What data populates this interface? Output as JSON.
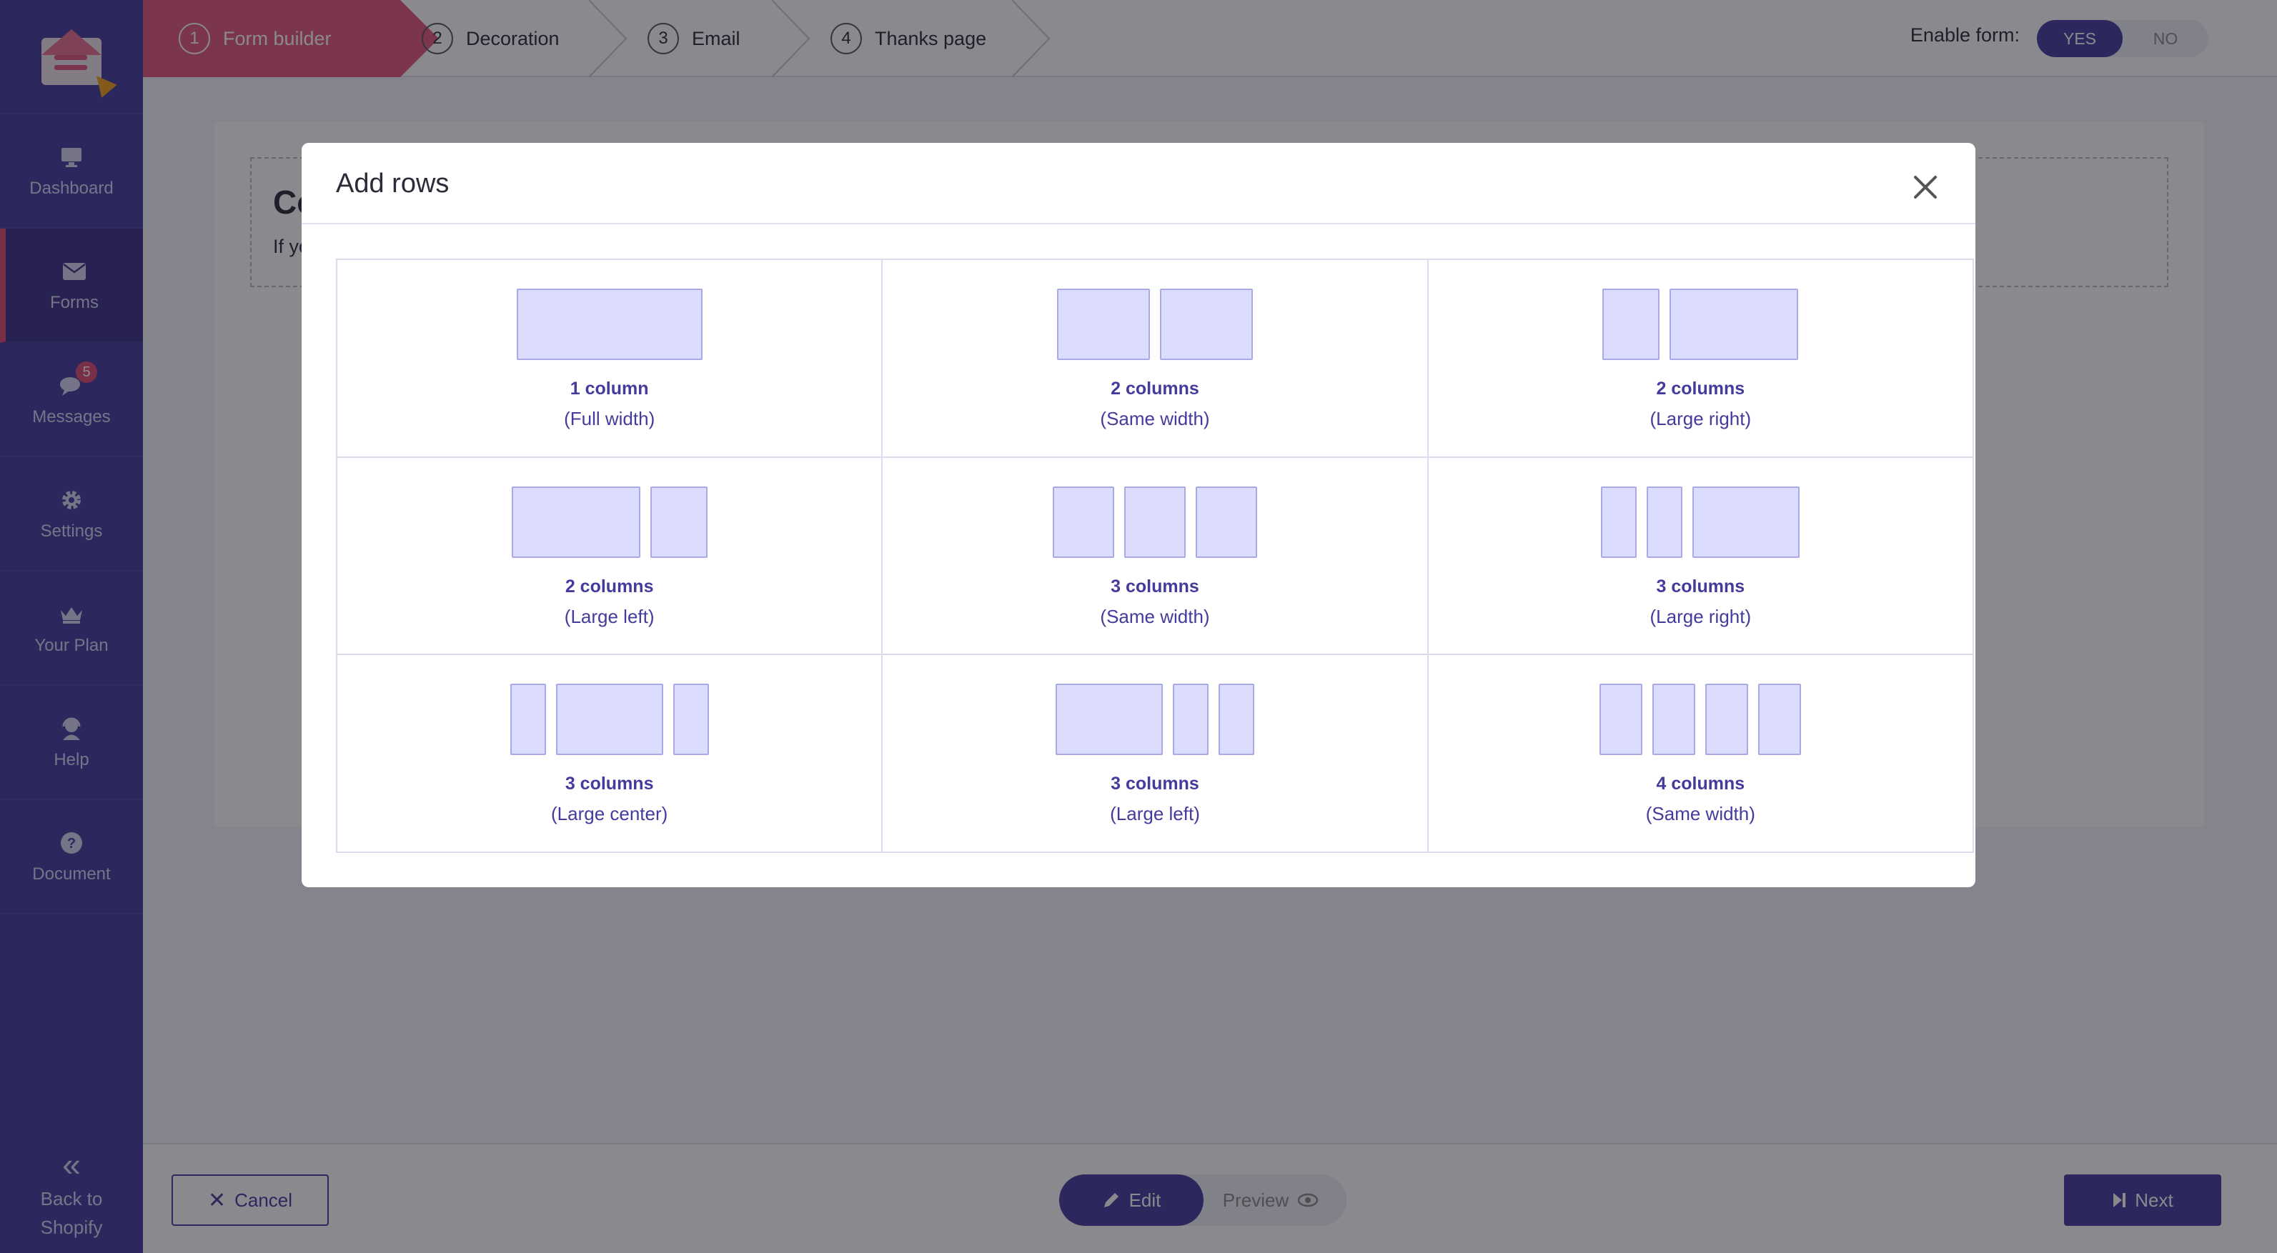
{
  "sidebar": {
    "items": [
      {
        "label": "Dashboard",
        "icon": "monitor-icon"
      },
      {
        "label": "Forms",
        "icon": "envelope-icon"
      },
      {
        "label": "Messages",
        "icon": "chat-icon",
        "badge": "5"
      },
      {
        "label": "Settings",
        "icon": "gear-icon"
      },
      {
        "label": "Your Plan",
        "icon": "crown-icon"
      },
      {
        "label": "Help",
        "icon": "support-agent-icon"
      },
      {
        "label": "Document",
        "icon": "question-circle-icon"
      }
    ],
    "back_line1": "Back to",
    "back_line2": "Shopify"
  },
  "steps": [
    {
      "num": "1",
      "label": "Form builder"
    },
    {
      "num": "2",
      "label": "Decoration"
    },
    {
      "num": "3",
      "label": "Email"
    },
    {
      "num": "4",
      "label": "Thanks page"
    }
  ],
  "enable_form": {
    "label": "Enable form:",
    "yes": "YES",
    "no": "NO"
  },
  "background": {
    "heading_partial": "Co",
    "text_partial": "If yo"
  },
  "modal": {
    "title": "Add rows",
    "options": [
      {
        "line1": "1 column",
        "line2": "(Full width)"
      },
      {
        "line1": "2 columns",
        "line2": "(Same width)"
      },
      {
        "line1": "2 columns",
        "line2": "(Large right)"
      },
      {
        "line1": "2 columns",
        "line2": "(Large left)"
      },
      {
        "line1": "3 columns",
        "line2": "(Same width)"
      },
      {
        "line1": "3 columns",
        "line2": "(Large right)"
      },
      {
        "line1": "3 columns",
        "line2": "(Large center)"
      },
      {
        "line1": "3 columns",
        "line2": "(Large left)"
      },
      {
        "line1": "4 columns",
        "line2": "(Same width)"
      }
    ]
  },
  "footer": {
    "cancel": "Cancel",
    "edit": "Edit",
    "preview": "Preview",
    "next": "Next"
  },
  "colors": {
    "primary": "#443b9c",
    "accent": "#e2577b",
    "preview_fill": "#dcdcff",
    "preview_border": "#a9a9e6"
  }
}
